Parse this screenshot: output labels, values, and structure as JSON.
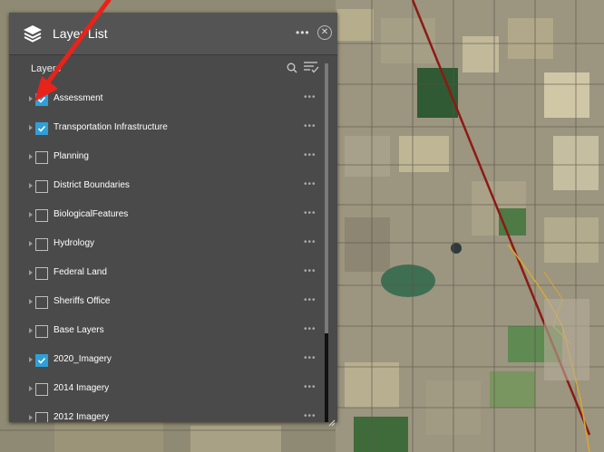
{
  "widget": {
    "title": "Layer List",
    "more_label": "•••",
    "close_label": "✕",
    "layers_label": "Layers"
  },
  "icons": {
    "panel": "layer-stack-icon",
    "search": "search-icon",
    "filter": "filter-list-icon",
    "caret": "caret-right-icon",
    "checkmark": "checkmark-icon",
    "close": "close-icon",
    "more": "ellipsis-icon"
  },
  "colors": {
    "checkbox_checked": "#2f9fd8",
    "panel_bg": "#4a4a4a",
    "annotation_arrow": "#e8231a"
  },
  "layers": [
    {
      "label": "Assessment",
      "checked": true
    },
    {
      "label": "Transportation Infrastructure",
      "checked": true
    },
    {
      "label": "Planning",
      "checked": false
    },
    {
      "label": "District Boundaries",
      "checked": false
    },
    {
      "label": "BiologicalFeatures",
      "checked": false
    },
    {
      "label": "Hydrology",
      "checked": false
    },
    {
      "label": "Federal Land",
      "checked": false
    },
    {
      "label": "Sheriffs Office",
      "checked": false
    },
    {
      "label": "Base Layers",
      "checked": false
    },
    {
      "label": "2020_Imagery",
      "checked": true
    },
    {
      "label": "2014 Imagery",
      "checked": false
    },
    {
      "label": "2012 Imagery",
      "checked": false
    }
  ],
  "layer_more_label": "•••"
}
